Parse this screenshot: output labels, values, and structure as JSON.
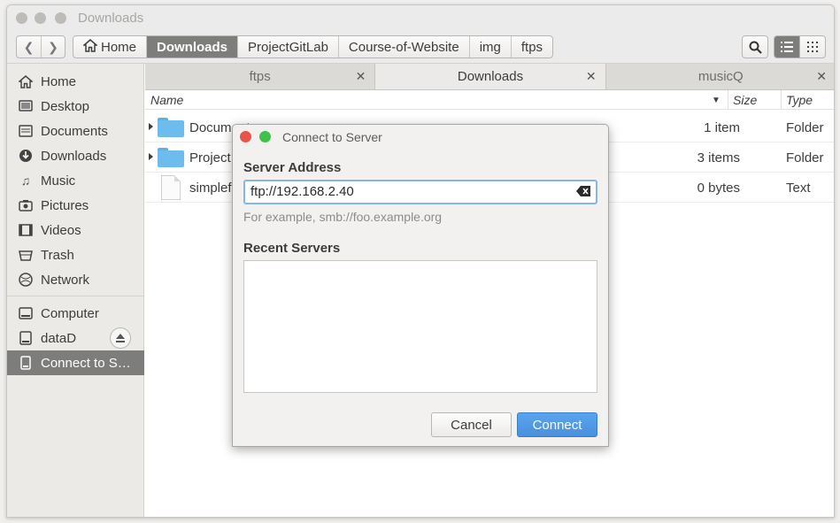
{
  "window": {
    "title": "Downloads"
  },
  "toolbar": {
    "back_icon": "chevron-left-icon",
    "forward_icon": "chevron-right-icon",
    "breadcrumbs": [
      "Home",
      "Downloads",
      "ProjectGitLab",
      "Course-of-Website",
      "img",
      "ftps"
    ],
    "active_crumb": "Downloads"
  },
  "sidebar": {
    "items": [
      {
        "label": "Home",
        "icon": "home-icon"
      },
      {
        "label": "Desktop",
        "icon": "desktop-icon"
      },
      {
        "label": "Documents",
        "icon": "documents-icon"
      },
      {
        "label": "Downloads",
        "icon": "download-icon"
      },
      {
        "label": "Music",
        "icon": "music-icon"
      },
      {
        "label": "Pictures",
        "icon": "camera-icon"
      },
      {
        "label": "Videos",
        "icon": "video-icon"
      },
      {
        "label": "Trash",
        "icon": "trash-icon"
      },
      {
        "label": "Network",
        "icon": "network-icon"
      }
    ],
    "devices": [
      {
        "label": "Computer",
        "icon": "computer-icon"
      },
      {
        "label": "dataD",
        "icon": "drive-icon"
      },
      {
        "label": "Connect to S…",
        "icon": "server-icon"
      }
    ]
  },
  "tabs": [
    {
      "label": "ftps"
    },
    {
      "label": "Downloads"
    },
    {
      "label": "musicQ"
    }
  ],
  "columns": {
    "name": "Name",
    "size": "Size",
    "type": "Type"
  },
  "files": [
    {
      "name": "Documents",
      "size": "1 item",
      "type": "Folder"
    },
    {
      "name": "Project",
      "size": "3 items",
      "type": "Folder"
    },
    {
      "name": "simplef",
      "size": "0 bytes",
      "type": "Text"
    }
  ],
  "dialog": {
    "title": "Connect to Server",
    "server_address_label": "Server Address",
    "server_address_value": "ftp://192.168.2.40",
    "hint": "For example, smb://foo.example.org",
    "recent_label": "Recent Servers",
    "cancel_label": "Cancel",
    "connect_label": "Connect"
  },
  "colors": {
    "accent": "#4a90dc",
    "selected": "#7d7d7b",
    "folder": "#6cbcee"
  }
}
